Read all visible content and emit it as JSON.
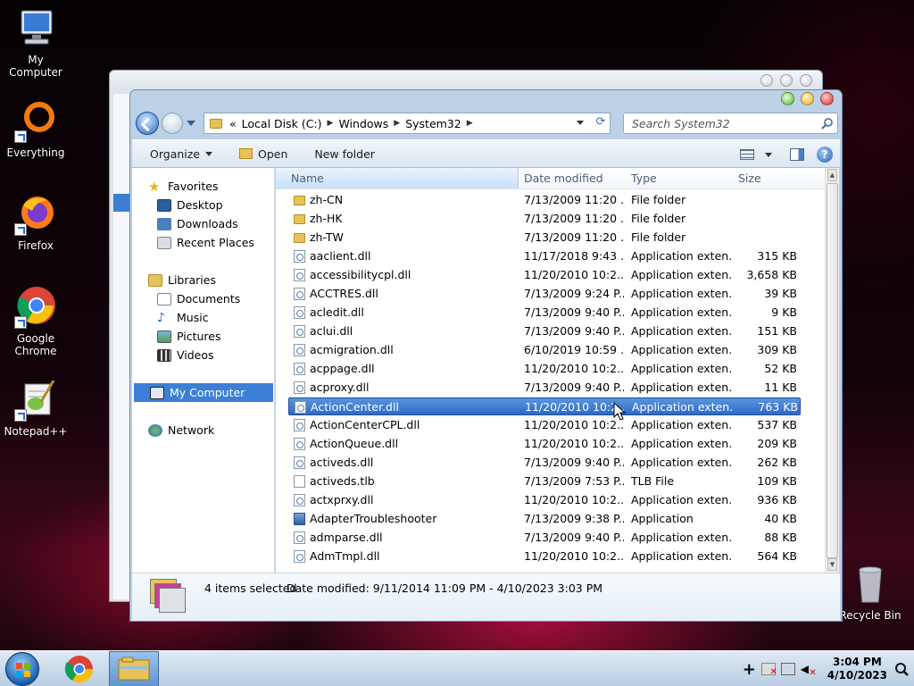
{
  "desktop": {
    "icons": [
      {
        "label": "My Computer"
      },
      {
        "label": "Everything"
      },
      {
        "label": "Firefox"
      },
      {
        "label": "Google Chrome"
      },
      {
        "label": "Notepad++"
      },
      {
        "label": "Recycle Bin"
      }
    ]
  },
  "explorer": {
    "breadcrumb": [
      "Local Disk (C:)",
      "Windows",
      "System32"
    ],
    "breadcrumb_prefix": "«",
    "search_placeholder": "Search System32",
    "toolbar": {
      "organize": "Organize",
      "open": "Open",
      "new_folder": "New folder"
    },
    "nav": {
      "favorites": "Favorites",
      "desktop": "Desktop",
      "downloads": "Downloads",
      "recent": "Recent Places",
      "libraries": "Libraries",
      "documents": "Documents",
      "music": "Music",
      "pictures": "Pictures",
      "videos": "Videos",
      "my_computer": "My Computer",
      "network": "Network"
    },
    "columns": {
      "name": "Name",
      "date": "Date modified",
      "type": "Type",
      "size": "Size"
    },
    "files": [
      {
        "name": "zh-CN",
        "date": "7/13/2009 11:20 ...",
        "type": "File folder",
        "size": "",
        "icon": "folder"
      },
      {
        "name": "zh-HK",
        "date": "7/13/2009 11:20 ...",
        "type": "File folder",
        "size": "",
        "icon": "folder"
      },
      {
        "name": "zh-TW",
        "date": "7/13/2009 11:20 ...",
        "type": "File folder",
        "size": "",
        "icon": "folder"
      },
      {
        "name": "aaclient.dll",
        "date": "11/17/2018 9:43 ...",
        "type": "Application exten...",
        "size": "315 KB",
        "icon": "dll"
      },
      {
        "name": "accessibilitycpl.dll",
        "date": "11/20/2010 10:2...",
        "type": "Application exten...",
        "size": "3,658 KB",
        "icon": "dll"
      },
      {
        "name": "ACCTRES.dll",
        "date": "7/13/2009 9:24 P...",
        "type": "Application exten...",
        "size": "39 KB",
        "icon": "dll"
      },
      {
        "name": "acledit.dll",
        "date": "7/13/2009 9:40 P...",
        "type": "Application exten...",
        "size": "9 KB",
        "icon": "dll"
      },
      {
        "name": "aclui.dll",
        "date": "7/13/2009 9:40 P...",
        "type": "Application exten...",
        "size": "151 KB",
        "icon": "dll"
      },
      {
        "name": "acmigration.dll",
        "date": "6/10/2019 10:59 ...",
        "type": "Application exten...",
        "size": "309 KB",
        "icon": "dll"
      },
      {
        "name": "acppage.dll",
        "date": "11/20/2010 10:2...",
        "type": "Application exten...",
        "size": "52 KB",
        "icon": "dll"
      },
      {
        "name": "acproxy.dll",
        "date": "7/13/2009 9:40 P...",
        "type": "Application exten...",
        "size": "11 KB",
        "icon": "dll"
      },
      {
        "name": "ActionCenter.dll",
        "date": "11/20/2010 10:2...",
        "type": "Application exten...",
        "size": "763 KB",
        "icon": "dll",
        "selected": true
      },
      {
        "name": "ActionCenterCPL.dll",
        "date": "11/20/2010 10:2...",
        "type": "Application exten...",
        "size": "537 KB",
        "icon": "dll"
      },
      {
        "name": "ActionQueue.dll",
        "date": "11/20/2010 10:2...",
        "type": "Application exten...",
        "size": "209 KB",
        "icon": "dll"
      },
      {
        "name": "activeds.dll",
        "date": "7/13/2009 9:40 P...",
        "type": "Application exten...",
        "size": "262 KB",
        "icon": "dll"
      },
      {
        "name": "activeds.tlb",
        "date": "7/13/2009 7:53 P...",
        "type": "TLB File",
        "size": "109 KB",
        "icon": "tlb"
      },
      {
        "name": "actxprxy.dll",
        "date": "11/20/2010 10:2...",
        "type": "Application exten...",
        "size": "936 KB",
        "icon": "dll"
      },
      {
        "name": "AdapterTroubleshooter",
        "date": "7/13/2009 9:38 P...",
        "type": "Application",
        "size": "40 KB",
        "icon": "app"
      },
      {
        "name": "admparse.dll",
        "date": "7/13/2009 9:40 P...",
        "type": "Application exten...",
        "size": "88 KB",
        "icon": "dll"
      },
      {
        "name": "AdmTmpl.dll",
        "date": "11/20/2010 10:2...",
        "type": "Application exten...",
        "size": "564 KB",
        "icon": "dll"
      }
    ],
    "details": {
      "selected_count": "4 items selected",
      "date_modified": "Date modified: 9/11/2014 11:09 PM - 4/10/2023 3:03 PM"
    }
  },
  "taskbar": {
    "time": "3:04 PM",
    "date": "4/10/2023"
  }
}
